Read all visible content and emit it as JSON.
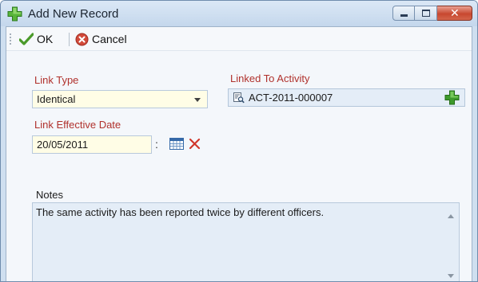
{
  "window": {
    "title": "Add New Record",
    "icon": "add-record-plus-icon",
    "controls": {
      "minimize": "minimize-icon",
      "maximize": "maximize-icon",
      "close": "close-icon",
      "close_glyph": "✕"
    }
  },
  "toolbar": {
    "ok_label": "OK",
    "ok_icon": "checkmark-icon",
    "cancel_label": "Cancel",
    "cancel_icon": "cancel-icon"
  },
  "form": {
    "link_type": {
      "label": "Link Type",
      "value": "Identical",
      "required": true
    },
    "linked_to_activity": {
      "label": "Linked To Activity",
      "value": "ACT-2011-000007",
      "required": true,
      "lookup_icon": "lookup-icon",
      "add_icon": "add-icon"
    },
    "link_effective_date": {
      "label": "Link Effective Date",
      "value": "20/05/2011",
      "required": true,
      "calendar_icon": "calendar-icon",
      "clear_icon": "clear-x-icon"
    },
    "notes": {
      "label": "Notes",
      "value": "The same activity has been reported twice by different officers."
    }
  },
  "colors": {
    "required_label": "#b0312c",
    "field_yellow": "#fffde6",
    "field_blue": "#e4edf7",
    "ok_green": "#4a9a2a",
    "cancel_red": "#d24a3a",
    "add_green": "#3d9a2b"
  }
}
